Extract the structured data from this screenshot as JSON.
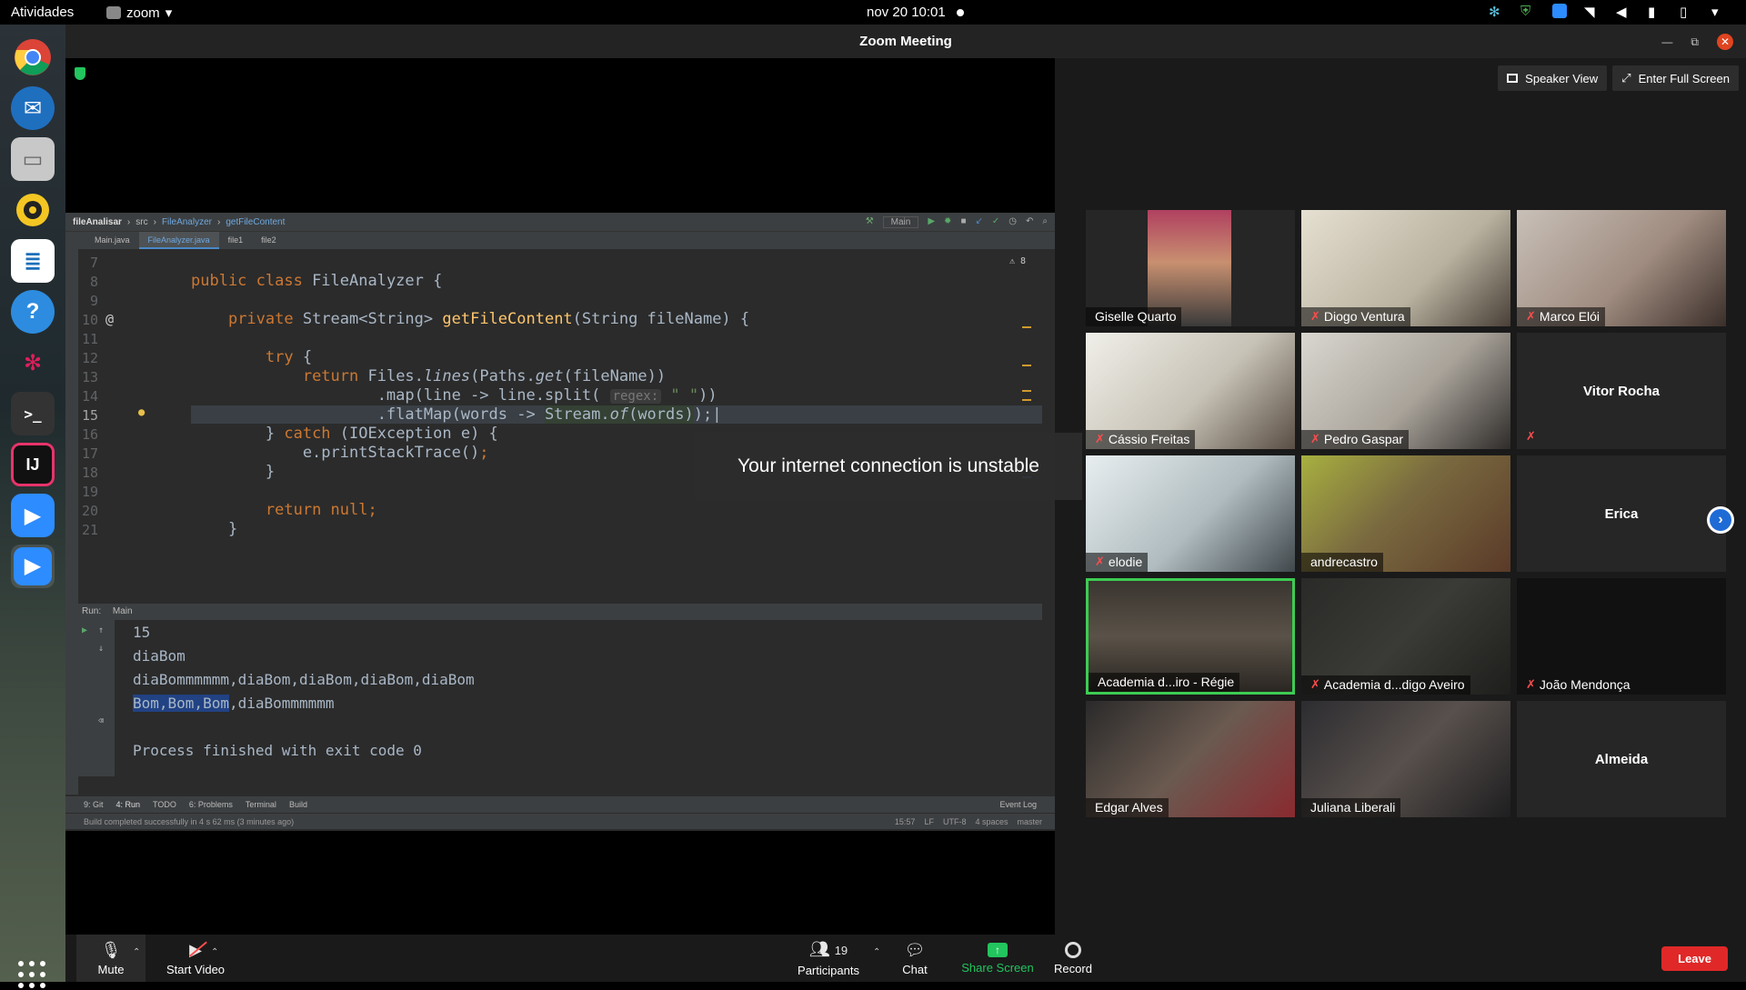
{
  "topbar": {
    "activities": "Atividades",
    "app_name": "zoom",
    "datetime": "nov 20  10:01"
  },
  "window": {
    "title": "Zoom Meeting"
  },
  "view": {
    "speaker": "Speaker View",
    "fullscreen": "Enter Full Screen"
  },
  "ide": {
    "breadcrumb": [
      "fileAnalisar",
      "src",
      "FileAnalyzer",
      "getFileContent"
    ],
    "run_config": "Main",
    "tabs": [
      "Main.java",
      "FileAnalyzer.java",
      "file1",
      "file2"
    ],
    "warnings": "⚠ 8",
    "lines": [
      "7",
      "8",
      "9",
      "10",
      "11",
      "12",
      "13",
      "14",
      "15",
      "16",
      "17",
      "18",
      "19",
      "20",
      "21"
    ],
    "run_label": "Run:",
    "run_tab": "Main",
    "console": {
      "l1": "15",
      "l2": "diaBom",
      "l3": "diaBommmmmm,diaBom,diaBom,diaBom,diaBom",
      "l4_sel": "Bom,Bom,Bom",
      "l4_rest": ",diaBommmmmm",
      "l5": "Process finished with exit code 0"
    },
    "bottom_tabs": [
      "9: Git",
      "4: Run",
      "TODO",
      "6: Problems",
      "Terminal",
      "Build"
    ],
    "event_log": "Event Log",
    "status_msg": "Build completed successfully in 4 s 62 ms (3 minutes ago)",
    "status_right": [
      "15:57",
      "LF",
      "UTF-8",
      "4 spaces",
      "master"
    ]
  },
  "toast": "Your internet connection is unstable",
  "participants": [
    {
      "name": "Giselle Quarto",
      "muted": false
    },
    {
      "name": "Diogo Ventura",
      "muted": true
    },
    {
      "name": "Marco Elói",
      "muted": true
    },
    {
      "name": "Cássio Freitas",
      "muted": true
    },
    {
      "name": "Pedro Gaspar",
      "muted": true
    },
    {
      "name": "Vitor Rocha",
      "muted": true
    },
    {
      "name": "elodie",
      "muted": true
    },
    {
      "name": "andrecastro",
      "muted": false
    },
    {
      "name": "Erica",
      "muted": false
    },
    {
      "name": "Academia d...iro - Régie",
      "muted": false
    },
    {
      "name": "Academia d...digo Aveiro",
      "muted": true
    },
    {
      "name": "João Mendonça",
      "muted": true
    },
    {
      "name": "Edgar Alves",
      "muted": false
    },
    {
      "name": "Juliana Liberali",
      "muted": false
    },
    {
      "name": "Almeida",
      "muted": false
    }
  ],
  "toolbar": {
    "mute": "Mute",
    "start_video": "Start Video",
    "participants": "Participants",
    "participant_count": "19",
    "chat": "Chat",
    "share_screen": "Share Screen",
    "record": "Record",
    "leave": "Leave"
  },
  "colors": {
    "accent_green": "#22c55e",
    "leave_red": "#e02828",
    "mute_red": "#ff4d4d",
    "active_speaker": "#3dcc52"
  }
}
